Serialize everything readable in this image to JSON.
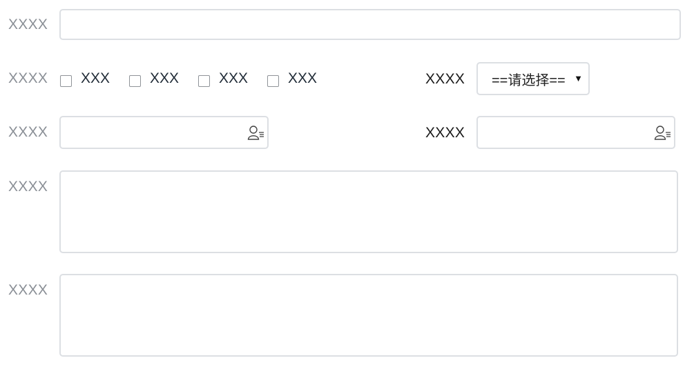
{
  "row1": {
    "label": "XXXX",
    "value": ""
  },
  "row2": {
    "label": "XXXX",
    "options": [
      {
        "label": "XXX",
        "checked": false
      },
      {
        "label": "XXX",
        "checked": false
      },
      {
        "label": "XXX",
        "checked": false
      },
      {
        "label": "XXX",
        "checked": false
      }
    ],
    "select_label": "XXXX",
    "select_value": "==请选择=="
  },
  "row3": {
    "left_label": "XXXX",
    "left_value": "",
    "right_label": "XXXX",
    "right_value": "",
    "icon": "user-picker-icon"
  },
  "row4": {
    "label": "XXXX",
    "value": ""
  },
  "row5": {
    "label": "XXXX",
    "value": ""
  },
  "colors": {
    "label_gray": "#8a8f96",
    "border": "#dcdfe3",
    "checkbox_border": "#8f9398"
  }
}
